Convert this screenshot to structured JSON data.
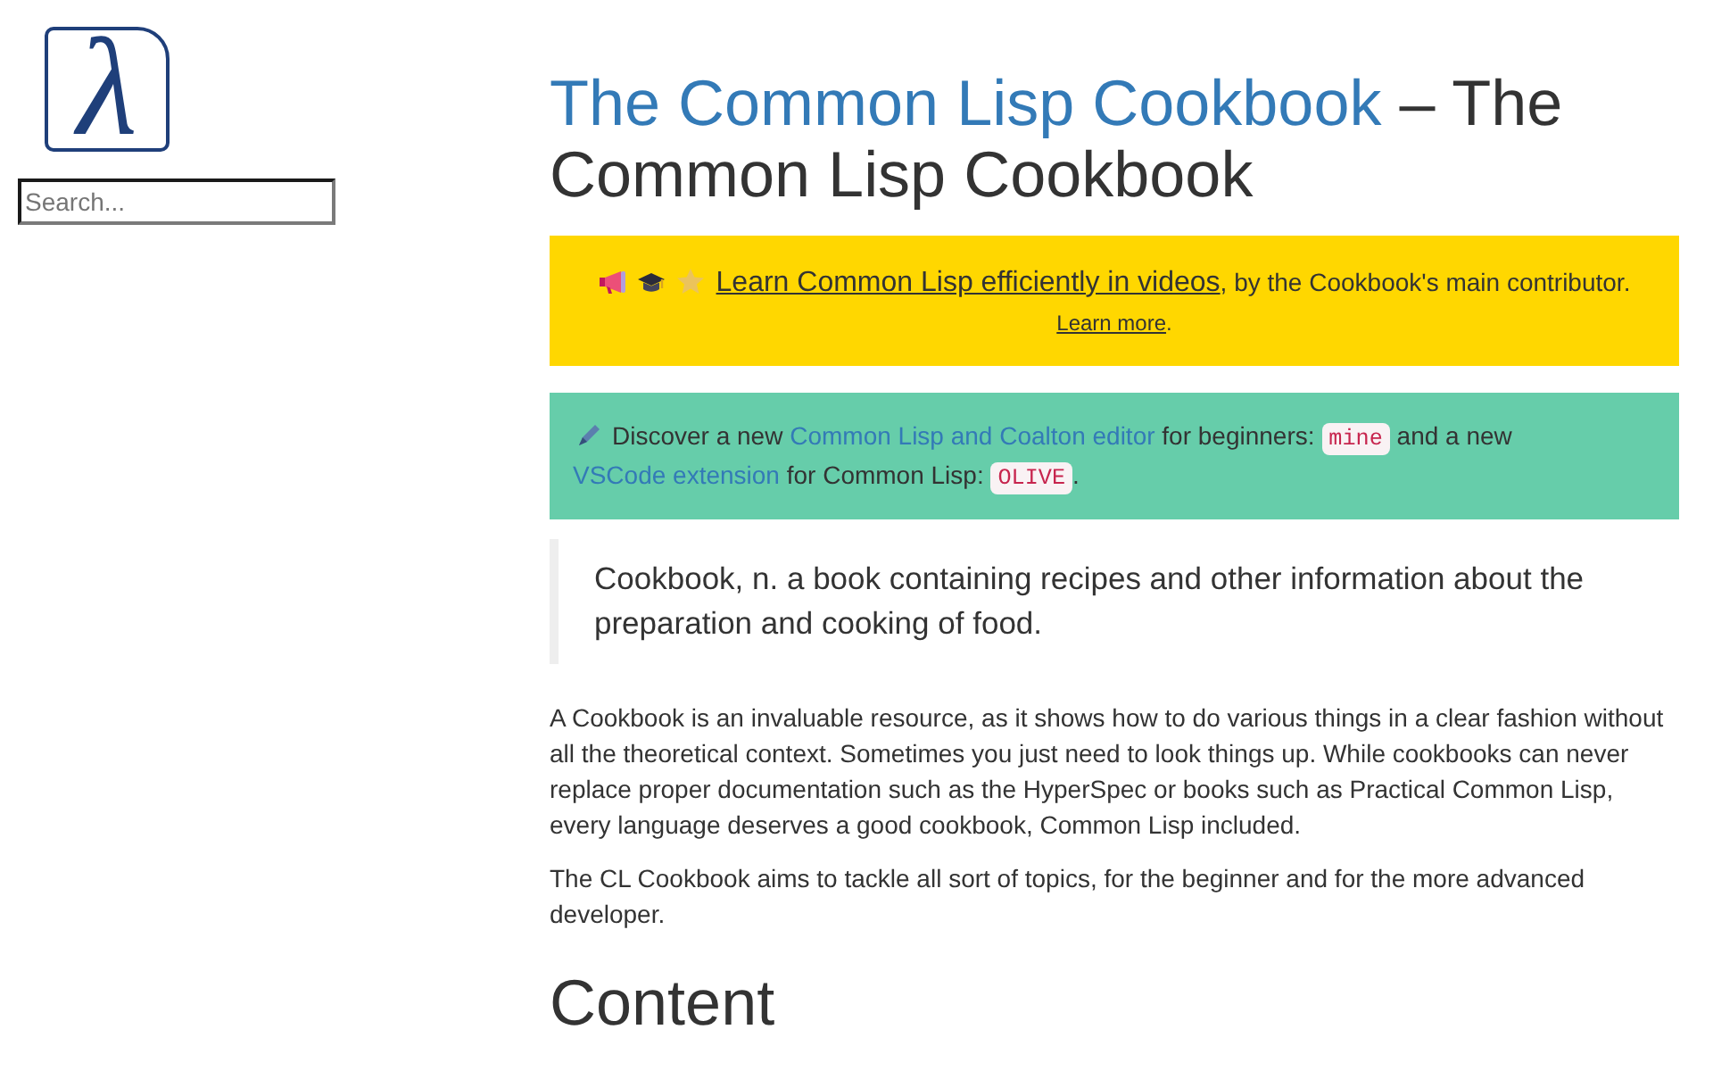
{
  "sidebar": {
    "logo": {
      "glyph": "λ"
    },
    "search": {
      "placeholder": "Search..."
    }
  },
  "title": {
    "link": "The Common Lisp Cookbook",
    "text": " – The Common Lisp Cookbook"
  },
  "announcement": {
    "lines": [
      [
        {
          "kind": "link",
          "text": "Learn Common Lisp efficiently in videos"
        },
        {
          "kind": "text",
          "text": ", by the Cookbook's main contributor."
        }
      ],
      [
        {
          "kind": "link",
          "text": "Learn more"
        },
        {
          "kind": "text",
          "text": "."
        }
      ]
    ]
  },
  "notice": {
    "parts": [
      {
        "kind": "text",
        "text": "Discover a new "
      },
      {
        "kind": "link",
        "text": "Common Lisp and Coalton editor"
      },
      {
        "kind": "text",
        "text": " for beginners: "
      },
      {
        "kind": "code",
        "text": "mine"
      },
      {
        "kind": "text",
        "text": " and a new "
      },
      {
        "kind": "link",
        "text": "VSCode extension"
      },
      {
        "kind": "text",
        "text": " for Common Lisp: "
      },
      {
        "kind": "code",
        "text": "OLIVE"
      },
      {
        "kind": "text",
        "text": "."
      }
    ]
  },
  "quote": "Cookbook, n. a book containing recipes and other information about the preparation and cooking of food.",
  "paragraphs": [
    "A Cookbook is an invaluable resource, as it shows how to do various things in a clear fashion without all the theoretical context. Sometimes you just need to look things up. While cookbooks can never replace proper documentation such as the HyperSpec or books such as Practical Common Lisp, every language deserves a good cookbook, Common Lisp included.",
    "The CL Cookbook aims to tackle all sort of topics, for the beginner and for the more advanced developer."
  ],
  "section_heading": "Content"
}
